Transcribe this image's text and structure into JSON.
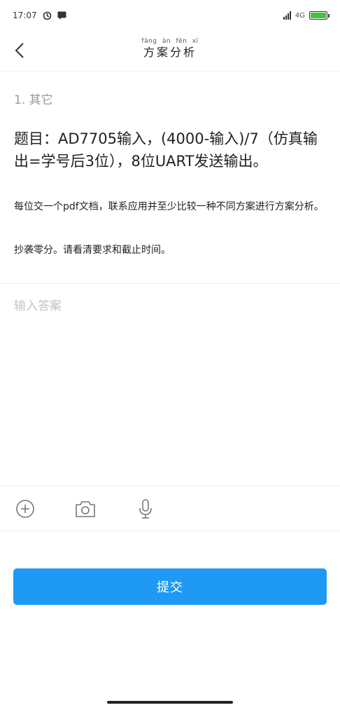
{
  "status_bar": {
    "time": "17:07",
    "network": "4G"
  },
  "header": {
    "pinyin": "fāng àn fēn xī",
    "title": "方案分析"
  },
  "question": {
    "number": "1. 其它",
    "headline": "题目：AD7705输入，(4000-输入)/7（仿真输出=学号后3位），8位UART发送输出。",
    "description": "每位交一个pdf文档，联系应用并至少比较一种不同方案进行方案分析。",
    "note": "抄袭零分。请看清要求和截止时间。"
  },
  "answer": {
    "placeholder": "输入答案",
    "value": ""
  },
  "toolbar": {
    "icons": [
      "add-icon",
      "camera-icon",
      "microphone-icon"
    ]
  },
  "submit": {
    "label": "提交"
  },
  "colors": {
    "accent": "#1e9af5",
    "battery": "#3ec63e"
  }
}
